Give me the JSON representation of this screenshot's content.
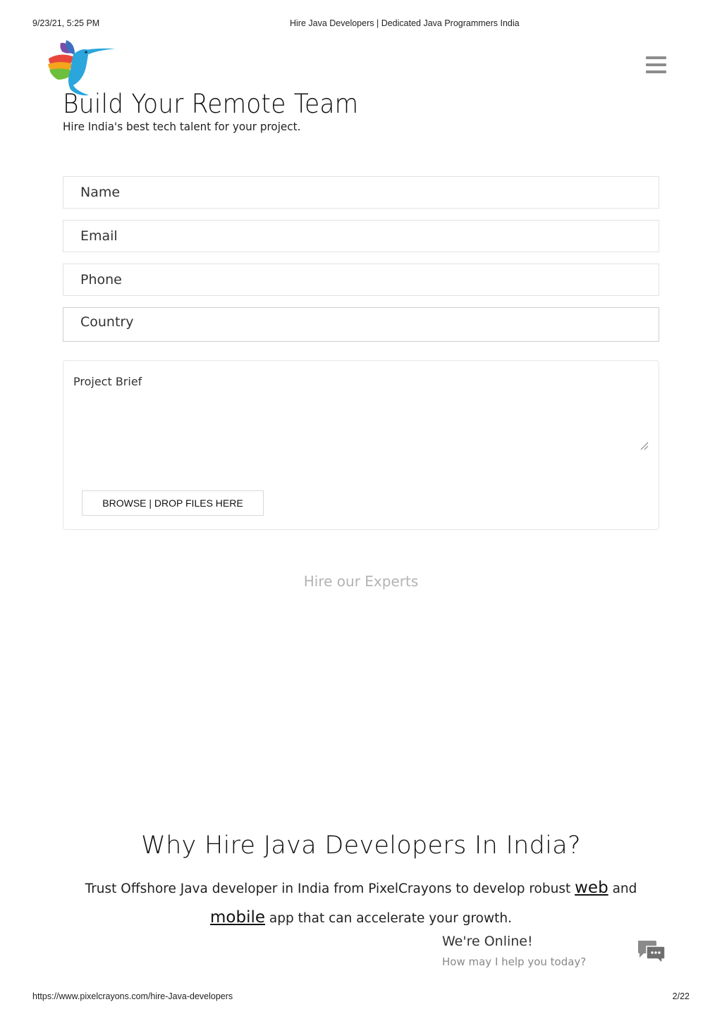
{
  "print_header": {
    "datetime": "9/23/21, 5:25 PM",
    "page_title": "Hire Java Developers | Dedicated Java Programmers India"
  },
  "print_footer": {
    "url": "https://www.pixelcrayons.com/hire-Java-developers",
    "page_number": "2/22"
  },
  "brand": {
    "logo_icon": "hummingbird-logo",
    "menu_icon": "hamburger-menu-icon",
    "colors": {
      "primary_text": "#111111",
      "muted_button": "#b3b3b3",
      "menu_gray": "#8c8c8c"
    }
  },
  "hero": {
    "title": "Build Your Remote Team",
    "subtitle": "Hire India's best tech talent for your project."
  },
  "form": {
    "name_placeholder": "Name",
    "email_placeholder": "Email",
    "phone_placeholder": "Phone",
    "country_value": "Country",
    "brief_placeholder": "Project Brief",
    "browse_label": "BROWSE | DROP FILES HERE",
    "submit_label": "Hire our Experts"
  },
  "why": {
    "title": "Why Hire Java Developers In India?",
    "text_before_web": "Trust Offshore Java developer in India from PixelCrayons to develop robust",
    "web_link": "web",
    "and_word": "and",
    "mobile_link": "mobile",
    "text_after_mobile": "app that can accelerate your growth."
  },
  "chat": {
    "status": "We're Online!",
    "prompt": "How may I help you today?",
    "icon": "chat-bubbles-icon"
  }
}
